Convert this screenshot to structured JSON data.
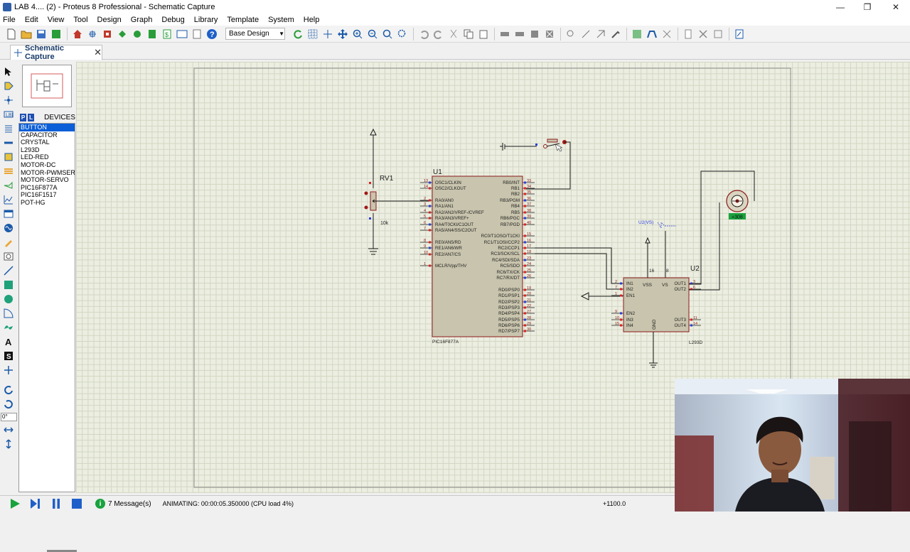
{
  "window": {
    "title": "LAB 4.... (2) - Proteus 8 Professional - Schematic Capture",
    "minimize": "—",
    "maximize": "❐",
    "close": "✕"
  },
  "menu": [
    "File",
    "Edit",
    "View",
    "Tool",
    "Design",
    "Graph",
    "Debug",
    "Library",
    "Template",
    "System",
    "Help"
  ],
  "toolbar": {
    "design_select": "Base Design"
  },
  "tab": {
    "label": "Schematic Capture",
    "close": "✕"
  },
  "devices": {
    "header": "DEVICES",
    "p_button": "P",
    "l_button": "L",
    "items": [
      "BUTTON",
      "CAPACITOR",
      "CRYSTAL",
      "L293D",
      "LED-RED",
      "MOTOR-DC",
      "MOTOR-PWMSER",
      "MOTOR-SERVO",
      "PIC16F877A",
      "PIC16F1517",
      "POT-HG"
    ],
    "selected": "BUTTON"
  },
  "rotation_field": "0°",
  "schematic": {
    "u1": {
      "ref": "U1",
      "part": "PIC16F877A",
      "left_pins": [
        {
          "num": "13",
          "name": "OSC1/CLKIN"
        },
        {
          "num": "14",
          "name": "OSC2/CLKOUT"
        },
        {
          "num": "2",
          "name": "RA0/AN0"
        },
        {
          "num": "3",
          "name": "RA1/AN1"
        },
        {
          "num": "4",
          "name": "RA2/AN2/VREF-/CVREF"
        },
        {
          "num": "5",
          "name": "RA3/AN3/VREF+"
        },
        {
          "num": "6",
          "name": "RA4/T0CKI/C1OUT"
        },
        {
          "num": "7",
          "name": "RA5/AN4/SS/C2OUT"
        },
        {
          "num": "8",
          "name": "RE0/AN5/RD"
        },
        {
          "num": "9",
          "name": "RE1/AN6/WR"
        },
        {
          "num": "10",
          "name": "RE2/AN7/CS"
        },
        {
          "num": "1",
          "name": "MCLR/Vpp/THV"
        }
      ],
      "right_pins": [
        {
          "num": "33",
          "name": "RB0/INT"
        },
        {
          "num": "34",
          "name": "RB1"
        },
        {
          "num": "35",
          "name": "RB2"
        },
        {
          "num": "36",
          "name": "RB3/PGM"
        },
        {
          "num": "37",
          "name": "RB4"
        },
        {
          "num": "38",
          "name": "RB5"
        },
        {
          "num": "39",
          "name": "RB6/PGC"
        },
        {
          "num": "40",
          "name": "RB7/PGD"
        },
        {
          "num": "15",
          "name": "RC0/T1OSO/T1CKI"
        },
        {
          "num": "16",
          "name": "RC1/T1OSI/CCP2"
        },
        {
          "num": "17",
          "name": "RC2/CCP1"
        },
        {
          "num": "18",
          "name": "RC3/SCK/SCL"
        },
        {
          "num": "23",
          "name": "RC4/SDI/SDA"
        },
        {
          "num": "24",
          "name": "RC5/SDO"
        },
        {
          "num": "25",
          "name": "RC6/TX/CK"
        },
        {
          "num": "26",
          "name": "RC7/RX/DT"
        },
        {
          "num": "19",
          "name": "RD0/PSP0"
        },
        {
          "num": "20",
          "name": "RD1/PSP1"
        },
        {
          "num": "21",
          "name": "RD2/PSP2"
        },
        {
          "num": "22",
          "name": "RD3/PSP3"
        },
        {
          "num": "27",
          "name": "RD4/PSP4"
        },
        {
          "num": "28",
          "name": "RD5/PSP5"
        },
        {
          "num": "29",
          "name": "RD6/PSP6"
        },
        {
          "num": "30",
          "name": "RD7/PSP7"
        }
      ]
    },
    "u2": {
      "ref": "U2",
      "part": "L293D",
      "vs_label": "U2(VS)",
      "left_pins": [
        {
          "num": "2",
          "name": "IN1"
        },
        {
          "num": "7",
          "name": "IN2"
        },
        {
          "num": "1",
          "name": "EN1"
        },
        {
          "num": "9",
          "name": "EN2"
        },
        {
          "num": "10",
          "name": "IN3"
        },
        {
          "num": "15",
          "name": "IN4"
        }
      ],
      "right_pins": [
        {
          "num": "3",
          "name": "OUT1"
        },
        {
          "num": "6",
          "name": "OUT2"
        },
        {
          "num": "11",
          "name": "OUT3"
        },
        {
          "num": "14",
          "name": "OUT4"
        }
      ],
      "top_pins": [
        {
          "num": "16",
          "name": "VSS"
        },
        {
          "num": "8",
          "name": "VS"
        }
      ],
      "gnd_label": "GND"
    },
    "rv1": {
      "ref": "RV1",
      "value": "10k"
    },
    "motor": {
      "readout": "+308"
    }
  },
  "status": {
    "messages": "7 Message(s)",
    "info_icon": "i",
    "animating": "ANIMATING: 00:00:05.350000 (CPU load 4%)",
    "coordinate": "+1100.0"
  },
  "colors": {
    "chip_fill": "#c8c4ad",
    "chip_border": "#8b1a1a",
    "wire": "#1a1a1a",
    "pin_number": "#8b1a1a",
    "selection": "#0a5ed7",
    "canvas_bg": "#eceee1"
  }
}
